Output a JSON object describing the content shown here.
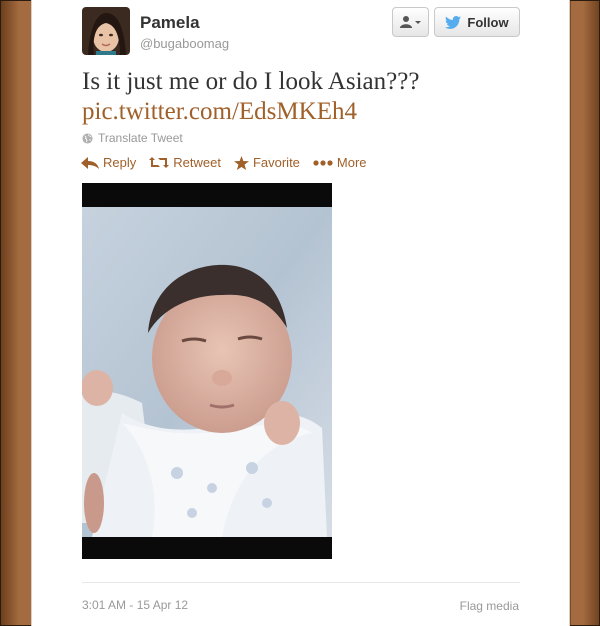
{
  "user": {
    "name": "Pamela",
    "handle": "@bugaboomag"
  },
  "header_buttons": {
    "user_menu_icon": "person-dropdown-icon",
    "follow_label": "Follow",
    "follow_icon": "twitter-bird-icon"
  },
  "tweet": {
    "text": "Is it just me or do I look Asian???",
    "link": "pic.twitter.com/EdsMKEh4",
    "translate_label": "Translate Tweet"
  },
  "actions": [
    {
      "label": "Reply",
      "icon": "reply-arrow-icon"
    },
    {
      "label": "Retweet",
      "icon": "retweet-icon"
    },
    {
      "label": "Favorite",
      "icon": "star-icon"
    },
    {
      "label": "More",
      "icon": "more-dots-icon"
    }
  ],
  "footer": {
    "timestamp": "3:01 AM - 15 Apr 12",
    "flag_label": "Flag media"
  },
  "colors": {
    "link": "#a0602a",
    "follow_bird": "#55acee",
    "frame_brown": "#7a4a26",
    "muted_text": "#999999"
  }
}
